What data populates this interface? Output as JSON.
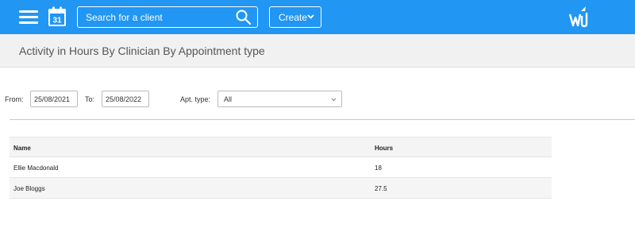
{
  "header": {
    "search_placeholder": "Search for a client",
    "create_label": "Create",
    "calendar_day": "31"
  },
  "page": {
    "title": "Activity in Hours By Clinician By Appointment type"
  },
  "filters": {
    "from_label": "From:",
    "from_value": "25/08/2021",
    "to_label": "To:",
    "to_value": "25/08/2022",
    "apt_type_label": "Apt. type:",
    "apt_type_value": "All"
  },
  "table": {
    "columns": [
      "Name",
      "Hours"
    ],
    "rows": [
      {
        "name": "Ellie Macdonald",
        "hours": "18"
      },
      {
        "name": "Joe Bloggs",
        "hours": "27.5"
      }
    ]
  },
  "colors": {
    "topbar": "#2196f3",
    "titlebar": "#f1f1f2"
  }
}
